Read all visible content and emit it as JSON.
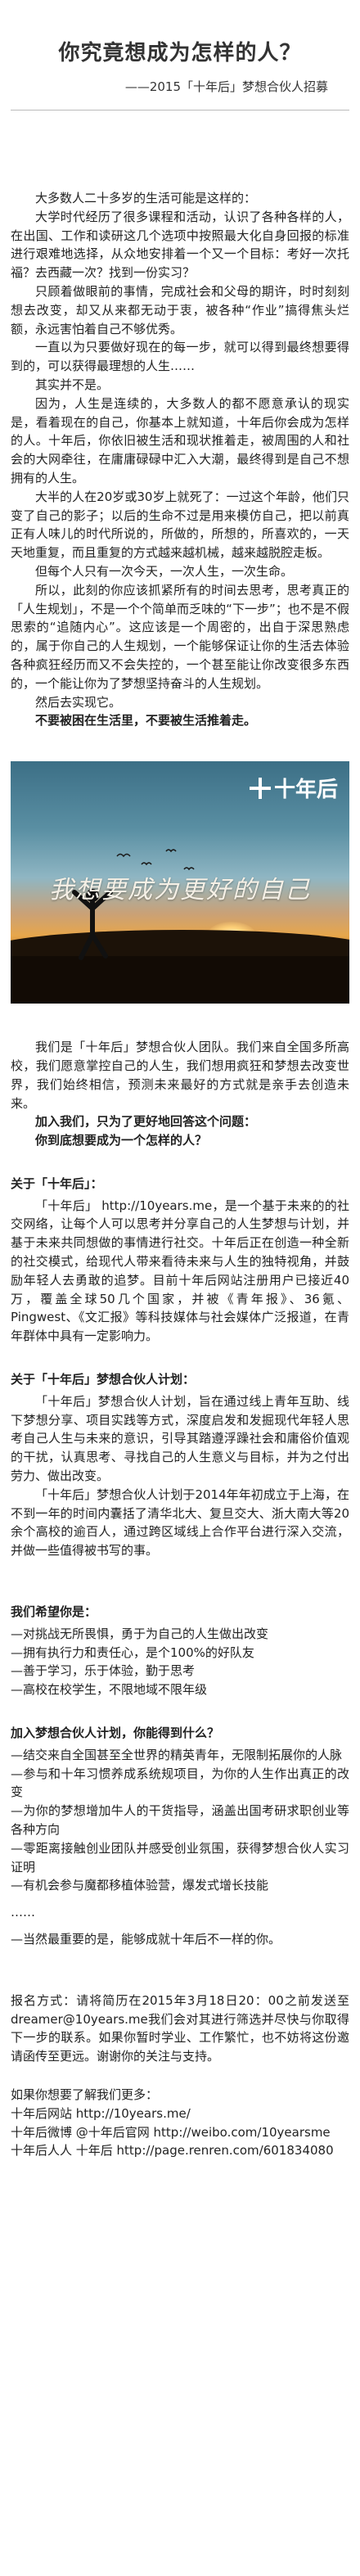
{
  "title": "你究竟想成为怎样的人？",
  "subtitle": "——2015「十年后」梦想合伙人招募",
  "intro": [
    "大多数人二十多岁的生活可能是这样的：",
    "大学时代经历了很多课程和活动，认识了各种各样的人，在出国、工作和读研这几个选项中按照最大化自身回报的标准进行艰难地选择，从众地安排着一个又一个目标：考好一次托福？去西藏一次？找到一份实习？",
    "只顾着做眼前的事情，完成社会和父母的期许，时时刻刻想去改变，却又从来都无动于衷，被各种“作业”搞得焦头烂额，永远害怕着自己不够优秀。",
    "一直以为只要做好现在的每一步，就可以得到最终想要得到的，可以获得最理想的人生……",
    "其实并不是。",
    "因为，人生是连续的，大多数人的都不愿意承认的现实是，看着现在的自己，你基本上就知道，十年后你会成为怎样的人。十年后，你依旧被生活和现状推着走，被周围的人和社会的大网牵往，在庸庸碌碌中汇入大潮，最终得到是自己不想拥有的人生。",
    "大半的人在20岁或30岁上就死了：一过这个年龄，他们只变了自己的影子；以后的生命不过是用来模仿自己，把以前真正有人味儿的时代所说的，所做的，所想的，所喜欢的，一天天地重复，而且重复的方式越来越机械，越来越脱腔走板。",
    "但每个人只有一次今天，一次人生，一次生命。",
    "所以，此刻的你应该抓紧所有的时间去思考，思考真正的「人生规划」，不是一个个简单而乏味的“下一步”；也不是不假思索的“追随内心”。这应该是一个周密的，出自于深思熟虑的，属于你自己的人生规划，一个能够保证让你的生活去体验各种疯狂经历而又不会失控的，一个甚至能让你改变很多东西的，一个能让你为了梦想坚持奋斗的人生规划。",
    "然后去实现它。",
    "不要被困在生活里，不要被生活推着走。"
  ],
  "photo": {
    "brand": "十年后",
    "slogan": "我想要成为更好的自己"
  },
  "team": [
    "我们是「十年后」梦想合伙人团队。我们来自全国多所高校，我们愿意掌控自己的人生，我们想用疯狂和梦想去改变世界，我们始终相信，预测未来最好的方式就是亲手去创造未来。",
    "加入我们，只为了更好地回答这个问题：",
    "你到底想要成为一个怎样的人？"
  ],
  "about": {
    "heading": "关于「十年后」：",
    "text": "「十年后」 http://10years.me，是一个基于未来的的社交网络，让每个人可以思考并分享自己的人生梦想与计划，并基于未来共同想做的事情进行社交。十年后正在创造一种全新的社交模式，给现代人带来看待未来与人生的独特视角，并鼓励年轻人去勇敢的追梦。目前十年后网站注册用户已接近40万，覆盖全球50几个国家，并被《青年报》、36氪、Pingwest、《文汇报》等科技媒体与社会媒体广泛报道，在青年群体中具有一定影响力。"
  },
  "program": {
    "heading": "关于「十年后」梦想合伙人计划：",
    "text1": "「十年后」梦想合伙人计划，旨在通过线上青年互助、线下梦想分享、项目实践等方式，深度启发和发掘现代年轻人思考自己人生与未来的意识，引导其踏遵浮躁社会和庸俗价值观的干扰，认真思考、寻找自己的人生意义与目标，并为之付出劳力、做出改变。",
    "text2": "「十年后」梦想合伙人计划于2014年年初成立于上海，在不到一年的时间内囊括了清华北大、复旦交大、浙大南大等20余个高校的逾百人，通过跨区域线上合作平台进行深入交流，并做一些值得被书写的事。"
  },
  "hope": {
    "heading": "我们希望你是：",
    "items": [
      "—对挑战无所畏惧，勇于为自己的人生做出改变",
      "—拥有执行力和责任心，是个100%的好队友",
      "—善于学习，乐于体验，勤于思考",
      "—高校在校学生，不限地域不限年级"
    ]
  },
  "gain": {
    "heading": "加入梦想合伙人计划，你能得到什么？",
    "items": [
      "—结交来自全国甚至全世界的精英青年，无限制拓展你的人脉",
      "—参与和十年习惯养成系统规项目，为你的人生作出真正的改变",
      "—为你的梦想增加牛人的干货指导，涵盖出国考研求职创业等各种方向",
      "—零距离接触创业团队并感受创业氛围，获得梦想合伙人实习证明",
      "—有机会参与魔都移植体验营，爆发式增长技能"
    ],
    "more": "……",
    "last": "—当然最重要的是，能够成就十年后不一样的你。"
  },
  "signup": {
    "text": "报名方式：请将简历在2015年3月18日20：00之前发送至dreamer@10years.me我们会对其进行筛选并尽快与你取得下一步的联系。如果你暂时学业、工作繁忙，也不妨将这份邀请函传至更远。谢谢你的关注与支持。"
  },
  "more_info": {
    "heading": "如果你想要了解我们更多：",
    "lines": [
      "十年后网站 http://10years.me/",
      "十年后微博 @十年后官网 http://weibo.com/10yearsme",
      "十年后人人 十年后 http://page.renren.com/601834080"
    ]
  }
}
